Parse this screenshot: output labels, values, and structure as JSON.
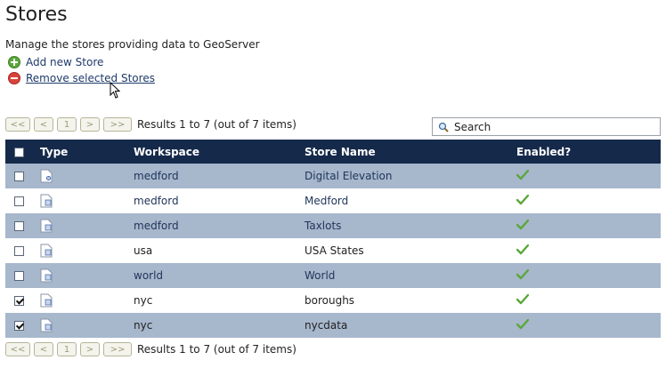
{
  "page": {
    "title": "Stores",
    "description": "Manage the stores providing data to GeoServer",
    "add_label": "Add new Store",
    "remove_label": "Remove selected Stores"
  },
  "pager": {
    "first": "<<",
    "prev": "<",
    "page": "1",
    "next": ">",
    "last": ">>",
    "results": "Results 1 to 7 (out of 7 items)"
  },
  "search": {
    "label": "Search"
  },
  "table": {
    "headers": {
      "type": "Type",
      "workspace": "Workspace",
      "store": "Store Name",
      "enabled": "Enabled?"
    },
    "rows": [
      {
        "workspace": "medford",
        "store": "Digital Elevation",
        "checked": false,
        "type_icon": "raster-store-icon"
      },
      {
        "workspace": "medford",
        "store": "Medford",
        "checked": false,
        "type_icon": "vector-store-icon"
      },
      {
        "workspace": "medford",
        "store": "Taxlots",
        "checked": false,
        "type_icon": "vector-store-icon"
      },
      {
        "workspace": "usa",
        "store": "USA States",
        "checked": false,
        "type_icon": "vector-store-icon"
      },
      {
        "workspace": "world",
        "store": "World",
        "checked": false,
        "type_icon": "vector-store-icon"
      },
      {
        "workspace": "nyc",
        "store": "boroughs",
        "checked": true,
        "type_icon": "vector-store-icon"
      },
      {
        "workspace": "nyc",
        "store": "nycdata",
        "checked": true,
        "type_icon": "vector-store-icon"
      }
    ]
  },
  "colors": {
    "header_bg": "#15294a",
    "odd_row": "#a7b7cc",
    "link": "#1e3a6a",
    "check": "#5aa83a"
  }
}
